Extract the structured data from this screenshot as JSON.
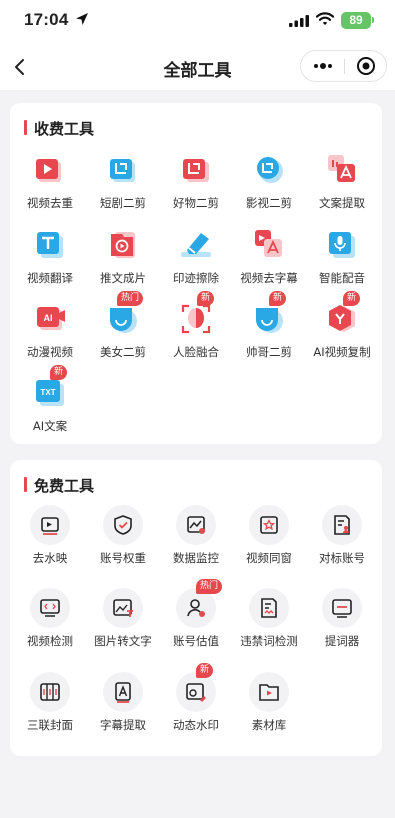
{
  "status": {
    "time": "17:04",
    "battery": "89"
  },
  "nav": {
    "title": "全部工具"
  },
  "paid": {
    "title": "收费工具",
    "tools": [
      {
        "label": "视频去重",
        "icon": "video-dedup-icon"
      },
      {
        "label": "短剧二剪",
        "icon": "crop-drama-icon"
      },
      {
        "label": "好物二剪",
        "icon": "crop-goods-icon"
      },
      {
        "label": "影视二剪",
        "icon": "crop-film-icon"
      },
      {
        "label": "文案提取",
        "icon": "text-extract-icon"
      },
      {
        "label": "视频翻译",
        "icon": "video-translate-icon"
      },
      {
        "label": "推文成片",
        "icon": "tweet-video-icon"
      },
      {
        "label": "印迹擦除",
        "icon": "eraser-icon"
      },
      {
        "label": "视频去字幕",
        "icon": "subtitle-remove-icon"
      },
      {
        "label": "智能配音",
        "icon": "mic-icon"
      },
      {
        "label": "动漫视频",
        "icon": "ai-anime-icon"
      },
      {
        "label": "美女二剪",
        "icon": "beauty-face-icon",
        "badge": "热门"
      },
      {
        "label": "人脸融合",
        "icon": "face-scan-icon",
        "badge": "新"
      },
      {
        "label": "帅哥二剪",
        "icon": "handsome-face-icon",
        "badge": "新"
      },
      {
        "label": "AI视频复制",
        "icon": "ai-video-copy-icon",
        "badge": "新"
      },
      {
        "label": "AI文案",
        "icon": "ai-text-icon",
        "badge": "新"
      }
    ]
  },
  "free": {
    "title": "免费工具",
    "tools": [
      {
        "label": "去水映",
        "icon": "remove-watermark-icon"
      },
      {
        "label": "账号权重",
        "icon": "shield-check-icon"
      },
      {
        "label": "数据监控",
        "icon": "chart-monitor-icon"
      },
      {
        "label": "视频同窗",
        "icon": "star-video-icon"
      },
      {
        "label": "对标账号",
        "icon": "benchmark-account-icon"
      },
      {
        "label": "视频检测",
        "icon": "video-check-icon"
      },
      {
        "label": "图片转文字",
        "icon": "image-to-text-icon"
      },
      {
        "label": "账号估值",
        "icon": "account-value-icon",
        "badge": "热门"
      },
      {
        "label": "违禁词检测",
        "icon": "banned-word-icon"
      },
      {
        "label": "提词器",
        "icon": "teleprompter-icon"
      },
      {
        "label": "三联封面",
        "icon": "triple-cover-icon"
      },
      {
        "label": "字幕提取",
        "icon": "subtitle-extract-icon"
      },
      {
        "label": "动态水印",
        "icon": "dynamic-watermark-icon",
        "badge": "新"
      },
      {
        "label": "素材库",
        "icon": "material-library-icon"
      }
    ]
  }
}
